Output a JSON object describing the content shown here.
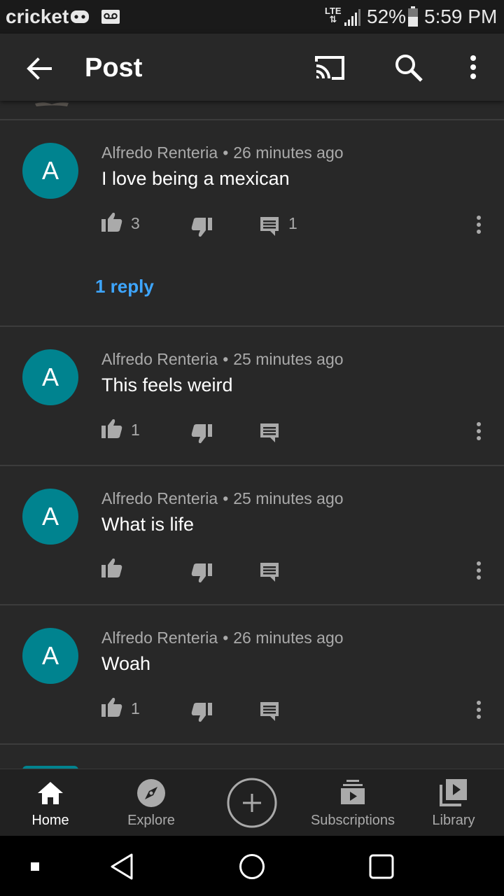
{
  "status_bar": {
    "carrier": "cricket",
    "network": "LTE",
    "battery": "52%",
    "time": "5:59 PM"
  },
  "app_bar": {
    "title": "Post"
  },
  "comments": [
    {
      "avatar_letter": "A",
      "author": "Alfredo Renteria",
      "time": "26 minutes ago",
      "text": "I love being a mexican",
      "likes": "3",
      "replies": "1",
      "reply_link": "1 reply"
    },
    {
      "avatar_letter": "A",
      "author": "Alfredo Renteria",
      "time": "25 minutes ago",
      "text": "This feels weird",
      "likes": "1",
      "replies": ""
    },
    {
      "avatar_letter": "A",
      "author": "Alfredo Renteria",
      "time": "25 minutes ago",
      "text": "What is life",
      "likes": "",
      "replies": ""
    },
    {
      "avatar_letter": "A",
      "author": "Alfredo Renteria",
      "time": "26 minutes ago",
      "text": "Woah",
      "likes": "1",
      "replies": ""
    }
  ],
  "bottom_nav": [
    {
      "label": "Home",
      "icon": "home-icon",
      "active": true
    },
    {
      "label": "Explore",
      "icon": "compass-icon",
      "active": false
    },
    {
      "label": "",
      "icon": "create-icon",
      "active": false
    },
    {
      "label": "Subscriptions",
      "icon": "subscriptions-icon",
      "active": false
    },
    {
      "label": "Library",
      "icon": "library-icon",
      "active": false
    }
  ],
  "colors": {
    "background": "#282828",
    "avatar": "#00838f",
    "link": "#3ea6ff",
    "secondary_text": "#aaaaaa"
  }
}
